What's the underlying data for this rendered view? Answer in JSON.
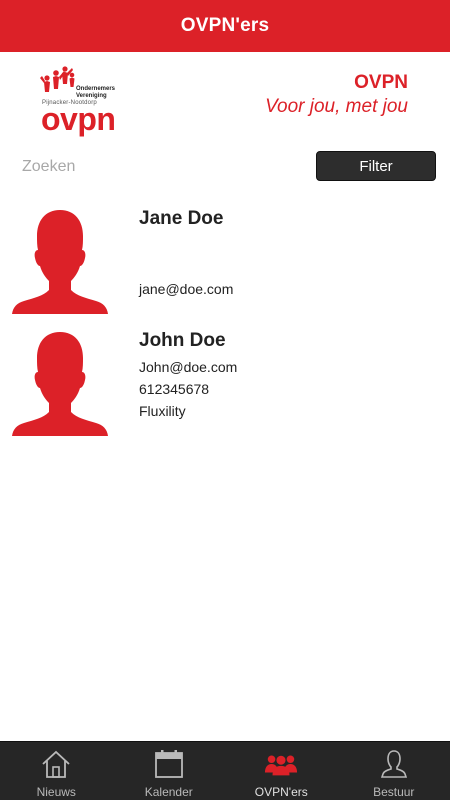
{
  "header": {
    "title": "OVPN'ers"
  },
  "brand": {
    "logo_word": "ovpn",
    "logo_line1": "Ondernemers",
    "logo_line2": "Vereniging",
    "logo_line3": "Pijnacker-Nootdorp",
    "name": "OVPN",
    "slogan": "Voor jou, met jou"
  },
  "search": {
    "placeholder": "Zoeken",
    "value": ""
  },
  "filter": {
    "label": "Filter"
  },
  "members": [
    {
      "name": "Jane Doe",
      "email": "jane@doe.com"
    },
    {
      "name": "John Doe",
      "email": "John@doe.com",
      "phone": "612345678",
      "company": "Fluxility"
    }
  ],
  "tabs": [
    {
      "label": "Nieuws",
      "icon": "home-icon"
    },
    {
      "label": "Kalender",
      "icon": "calendar-icon"
    },
    {
      "label": "OVPN'ers",
      "icon": "people-icon",
      "active": true
    },
    {
      "label": "Bestuur",
      "icon": "person-icon"
    }
  ],
  "colors": {
    "brand_red": "#dc2128",
    "tabbar_bg": "#262626",
    "filter_bg": "#2d2d2d"
  }
}
